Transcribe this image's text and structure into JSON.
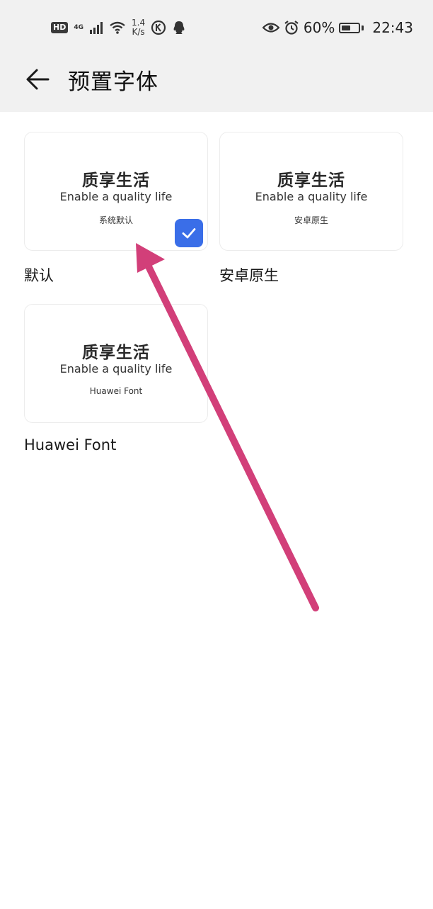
{
  "status_bar": {
    "hd_badge": "HD",
    "network_type": "4G",
    "net_speed_value": "1.4",
    "net_speed_unit": "K/s",
    "battery_percent": "60%",
    "battery_level": 0.6,
    "time": "22:43",
    "icons": [
      "signal-icon",
      "wifi-icon",
      "k-app-icon",
      "qq-icon",
      "eye-icon",
      "alarm-icon",
      "battery-icon"
    ]
  },
  "header": {
    "title": "预置字体",
    "back_icon": "back-arrow-icon"
  },
  "fonts": [
    {
      "preview_title": "质享生活",
      "preview_sub": "Enable a quality life",
      "preview_name": "系统默认",
      "label": "默认",
      "selected": true
    },
    {
      "preview_title": "质享生活",
      "preview_sub": "Enable a quality life",
      "preview_name": "安卓原生",
      "label": "安卓原生",
      "selected": false
    },
    {
      "preview_title": "质享生活",
      "preview_sub": "Enable a quality life",
      "preview_name": "Huawei Font",
      "label": "Huawei Font",
      "selected": false
    }
  ],
  "colors": {
    "accent": "#3a6ee8",
    "annotation_arrow": "#d23f79",
    "header_bg": "#f1f1f1"
  }
}
